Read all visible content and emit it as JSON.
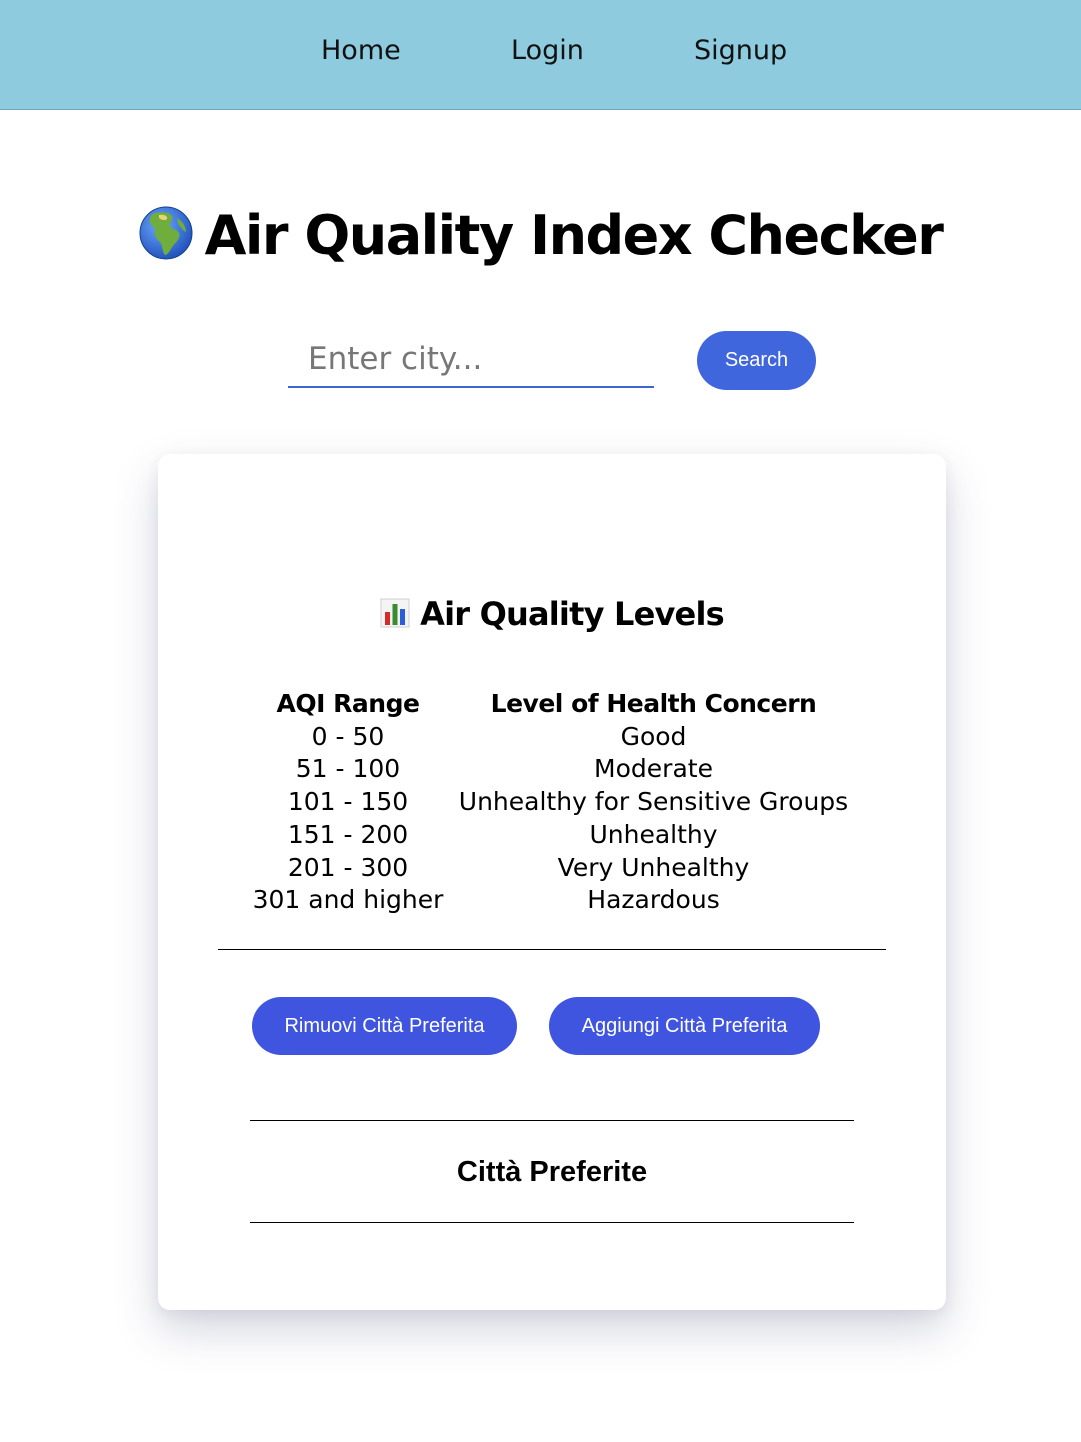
{
  "nav": {
    "home": "Home",
    "login": "Login",
    "signup": "Signup"
  },
  "header": {
    "icon": "globe-icon",
    "title": "Air Quality Index Checker"
  },
  "search": {
    "placeholder": "Enter city...",
    "value": "",
    "button_label": "Search"
  },
  "levels": {
    "icon": "bar-chart-icon",
    "title": "Air Quality Levels",
    "columns": [
      "AQI Range",
      "Level of Health Concern"
    ],
    "rows": [
      [
        "0 - 50",
        "Good"
      ],
      [
        "51 - 100",
        "Moderate"
      ],
      [
        "101 - 150",
        "Unhealthy for Sensitive Groups"
      ],
      [
        "151 - 200",
        "Unhealthy"
      ],
      [
        "201 - 300",
        "Very Unhealthy"
      ],
      [
        "301 and higher",
        "Hazardous"
      ]
    ]
  },
  "favorites": {
    "remove_label": "Rimuovi Città Preferita",
    "add_label": "Aggiungi Città Preferita",
    "title": "Città Preferite",
    "items": []
  },
  "colors": {
    "navbar": "#8ecbdf",
    "accent": "#3f66dc",
    "button": "#3f55e0"
  }
}
